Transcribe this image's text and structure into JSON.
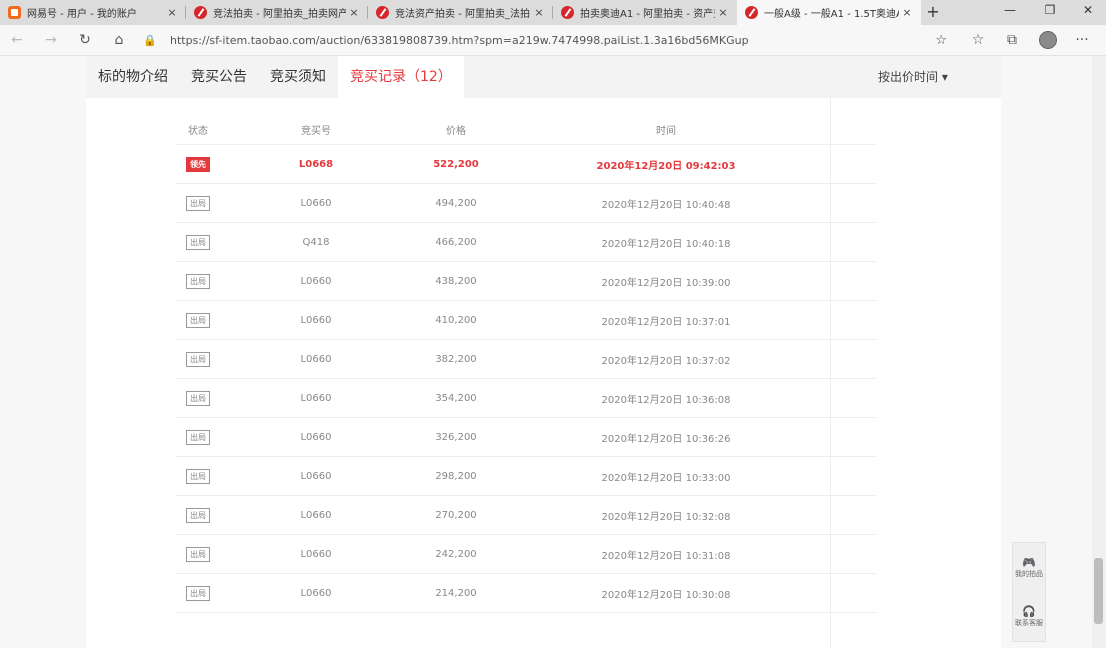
{
  "browser": {
    "tabs": [
      {
        "title": "网易号 - 用户 - 我的账户",
        "close": "×",
        "active": false
      },
      {
        "title": "竞法拍卖 - 阿里拍卖_拍卖网产",
        "close": "×",
        "active": false
      },
      {
        "title": "竞法资产拍卖 - 阿里拍卖_法拍",
        "close": "×",
        "active": false
      },
      {
        "title": "拍卖奥迪A1 - 阿里拍卖 - 资产交易",
        "close": "×",
        "active": false
      },
      {
        "title": "一般A级 - 一般A1 - 1.5T奥迪A1竞拍",
        "close": "×",
        "active": true
      }
    ],
    "new_tab": "+",
    "window_controls": {
      "minimize": "—",
      "restore": "❐",
      "close": "✕"
    },
    "nav": {
      "back": "←",
      "forward": "→",
      "refresh": "↻",
      "home": "⌂"
    },
    "url": "https://sf-item.taobao.com/auction/633819808739.htm?spm=a219w.7474998.paiList.1.3a16bd56MKGup",
    "toolbar": {
      "star": "☆",
      "favorites": "☆",
      "collections": "⧉",
      "menu": "···"
    }
  },
  "subnav": {
    "tabs": [
      "标的物介绍",
      "竞买公告",
      "竞买须知",
      "竞买记录（12）"
    ],
    "active_index": 3,
    "sort_label": "按出价时间 ▾"
  },
  "bids": {
    "headers": [
      "状态",
      "竞买号",
      "价格",
      "时间"
    ],
    "rows": [
      {
        "status": "领先",
        "bidder": "L0668",
        "price": "522,200",
        "time": "2020年12月20日 09:42:03",
        "leading": true
      },
      {
        "status": "出局",
        "bidder": "L0660",
        "price": "494,200",
        "time": "2020年12月20日 10:40:48",
        "leading": false
      },
      {
        "status": "出局",
        "bidder": "Q418",
        "price": "466,200",
        "time": "2020年12月20日 10:40:18",
        "leading": false
      },
      {
        "status": "出局",
        "bidder": "L0660",
        "price": "438,200",
        "time": "2020年12月20日 10:39:00",
        "leading": false
      },
      {
        "status": "出局",
        "bidder": "L0660",
        "price": "410,200",
        "time": "2020年12月20日 10:37:01",
        "leading": false
      },
      {
        "status": "出局",
        "bidder": "L0660",
        "price": "382,200",
        "time": "2020年12月20日 10:37:02",
        "leading": false
      },
      {
        "status": "出局",
        "bidder": "L0660",
        "price": "354,200",
        "time": "2020年12月20日 10:36:08",
        "leading": false
      },
      {
        "status": "出局",
        "bidder": "L0660",
        "price": "326,200",
        "time": "2020年12月20日 10:36:26",
        "leading": false
      },
      {
        "status": "出局",
        "bidder": "L0660",
        "price": "298,200",
        "time": "2020年12月20日 10:33:00",
        "leading": false
      },
      {
        "status": "出局",
        "bidder": "L0660",
        "price": "270,200",
        "time": "2020年12月20日 10:32:08",
        "leading": false
      },
      {
        "status": "出局",
        "bidder": "L0660",
        "price": "242,200",
        "time": "2020年12月20日 10:31:08",
        "leading": false
      },
      {
        "status": "出局",
        "bidder": "L0660",
        "price": "214,200",
        "time": "2020年12月20日 10:30:08",
        "leading": false
      }
    ]
  },
  "side_widget": {
    "items": [
      {
        "icon": "🎮",
        "label": "我的拍品"
      },
      {
        "icon": "🎧",
        "label": "联系客服"
      }
    ]
  }
}
